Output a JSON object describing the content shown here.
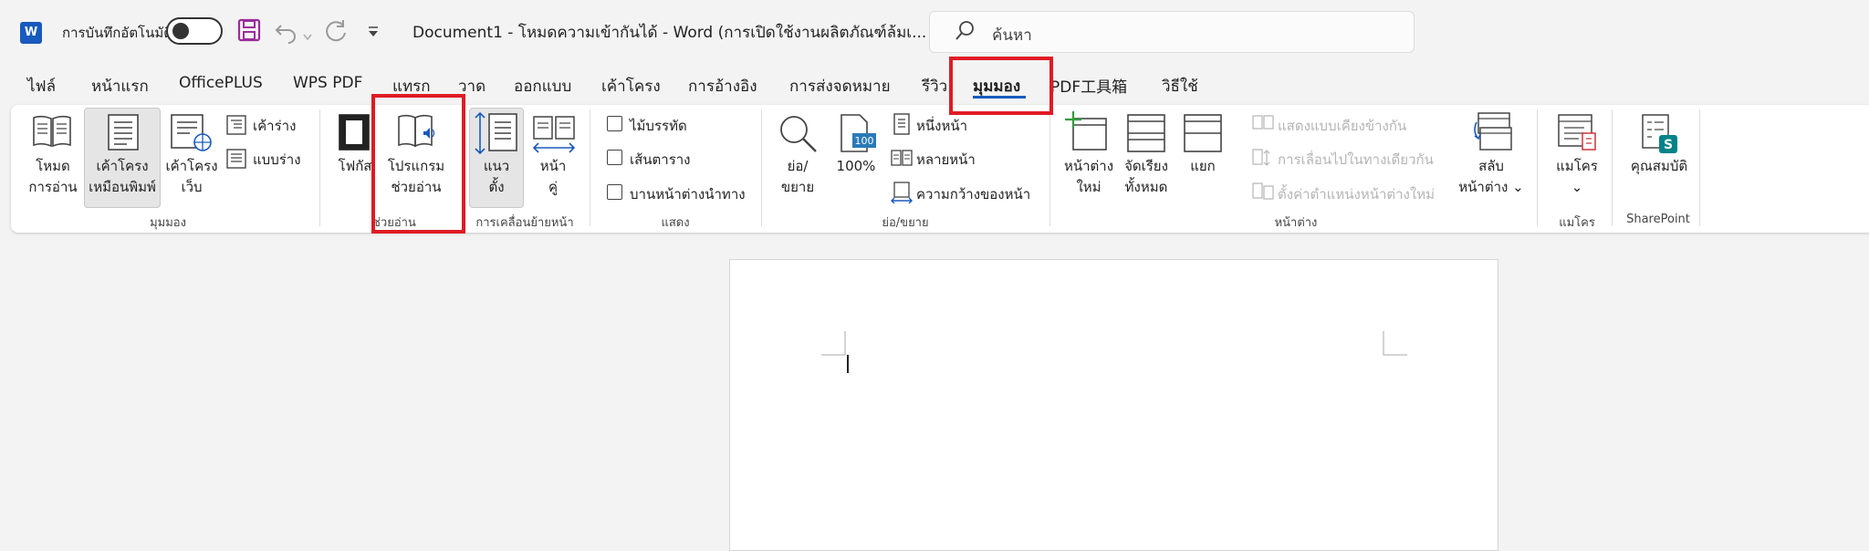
{
  "titlebar": {
    "logo": "W",
    "autosave_label": "การบันทึกอัตโนมัติ",
    "title": "Document1  -  โหมดความเข้ากันได้  -  Word (การเปิดใช้งานผลิตภัณฑ์ล้มเ...",
    "search_placeholder": "ค้นหา"
  },
  "tabs": [
    "ไฟล์",
    "หน้าแรก",
    "OfficePLUS",
    "WPS PDF",
    "แทรก",
    "วาด",
    "ออกแบบ",
    "เค้าโครง",
    "การอ้างอิง",
    "การส่งจดหมาย",
    "รีวิว",
    "มุมมอง",
    "PDF工具箱",
    "วิธีใช้"
  ],
  "ribbon": {
    "views": {
      "read_mode": [
        "โหมด",
        "การอ่าน"
      ],
      "print_layout": [
        "เค้าโครง",
        "เหมือนพิมพ์"
      ],
      "web_layout": [
        "เค้าโครง",
        "เว็บ"
      ],
      "outline": "เค้าร่าง",
      "draft": "แบบร่าง",
      "group": "มุมมอง"
    },
    "immersive": {
      "focus": "โฟกัส",
      "reader": [
        "โปรแกรม",
        "ช่วยอ่าน"
      ],
      "group": "ช่วยอ่าน"
    },
    "page_movement": {
      "vertical": [
        "แนว",
        "ตั้ง"
      ],
      "side_to_side": [
        "หน้า",
        "คู่"
      ],
      "group": "การเคลื่อนย้ายหน้า"
    },
    "show": {
      "ruler": "ไม้บรรทัด",
      "gridlines": "เส้นตาราง",
      "nav_pane": "บานหน้าต่างนำทาง",
      "group": "แสดง"
    },
    "zoom": {
      "zoom": [
        "ย่อ/",
        "ขยาย"
      ],
      "hundred": "100%",
      "one_page": "หนึ่งหน้า",
      "multiple_pages": "หลายหน้า",
      "page_width": "ความกว้างของหน้า",
      "group": "ย่อ/ขยาย"
    },
    "window": {
      "new_window": [
        "หน้าต่าง",
        "ใหม่"
      ],
      "arrange_all": [
        "จัดเรียง",
        "ทั้งหมด"
      ],
      "split": "แยก",
      "side_by_side": "แสดงแบบเคียงข้างกัน",
      "sync_scroll": "การเลื่อนไปในทางเดียวกัน",
      "reset_position": "ตั้งค่าตำแหน่งหน้าต่างใหม่",
      "switch": [
        "สลับ",
        "หน้าต่าง"
      ],
      "group": "หน้าต่าง"
    },
    "macros": {
      "label": "แมโคร",
      "group": "แมโคร"
    },
    "sharepoint": {
      "label": "คุณสมบัติ",
      "group": "SharePoint"
    }
  },
  "colors": {
    "accent": "#185abd",
    "highlight": "#e01b24"
  }
}
